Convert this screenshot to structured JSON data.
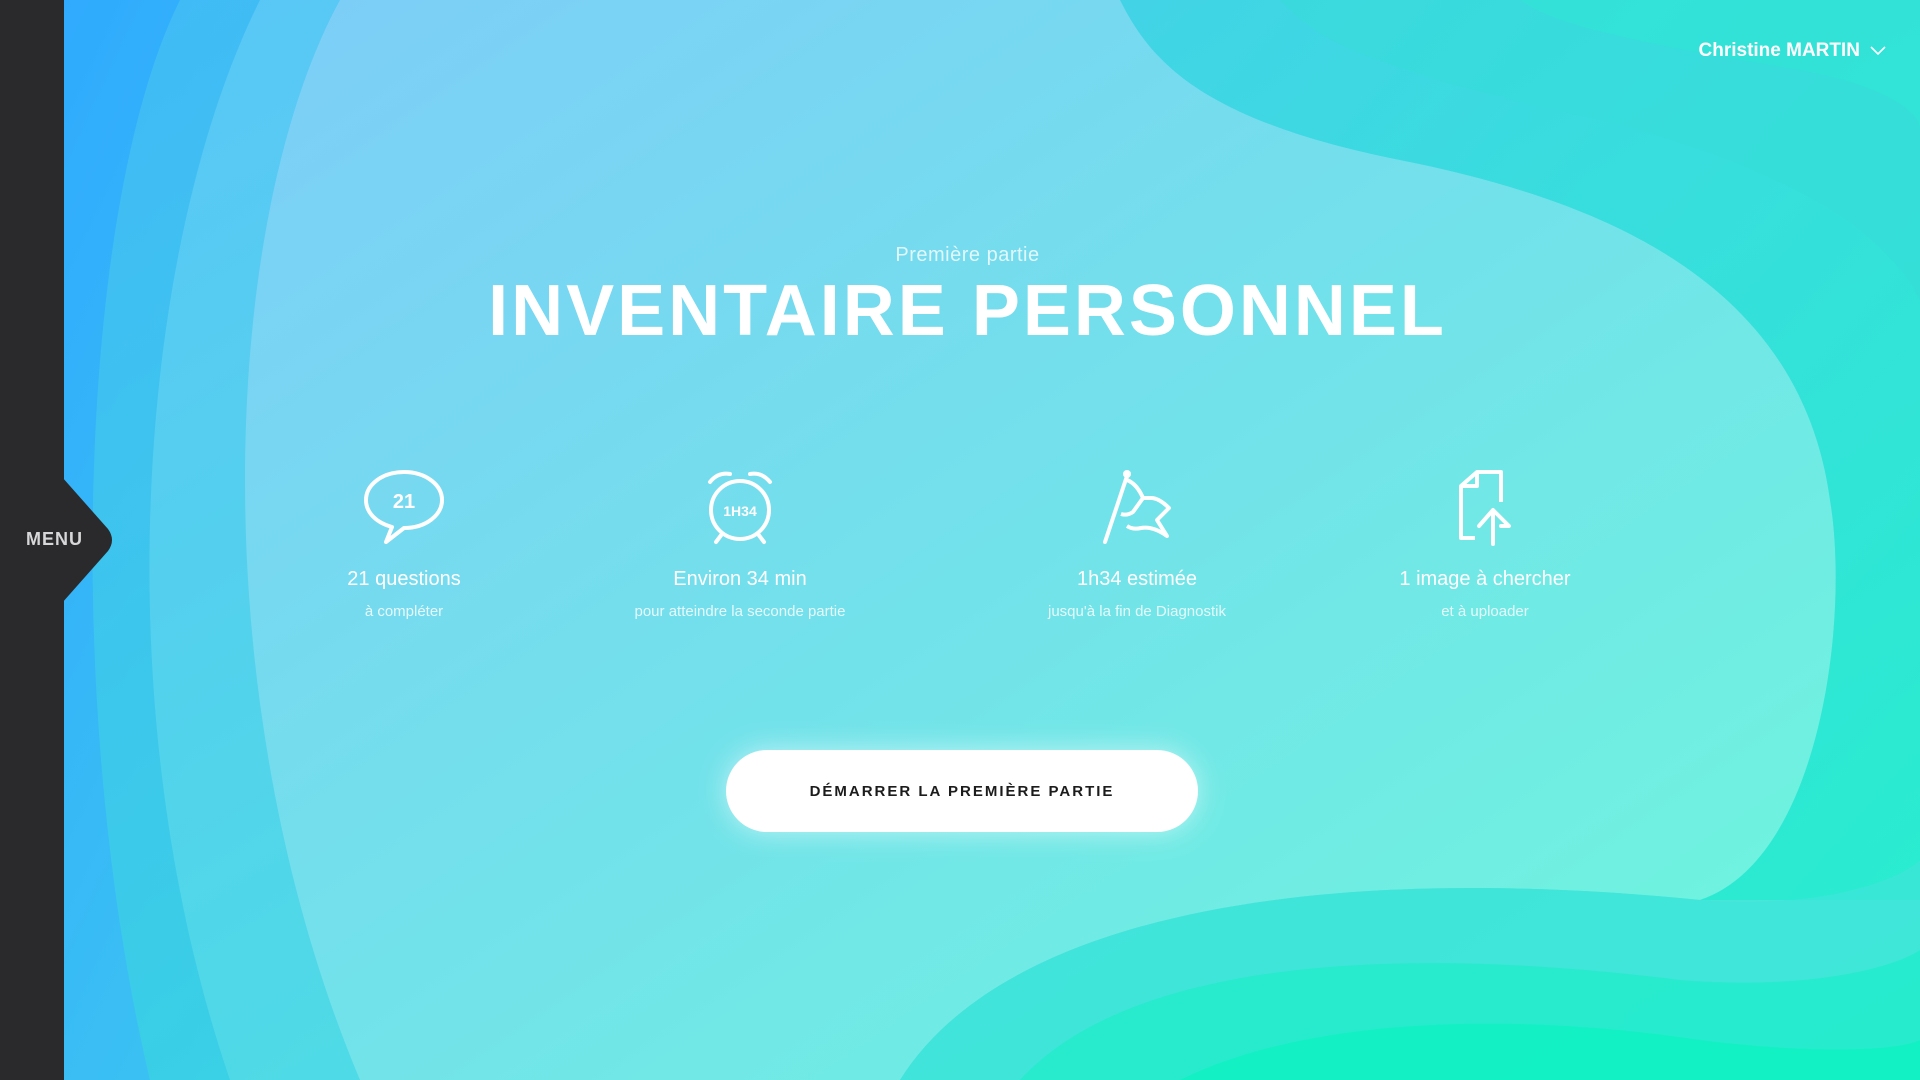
{
  "sidebar": {
    "menu_label": "MENU"
  },
  "user": {
    "name": "Christine MARTIN",
    "icon": "chevron-down-icon"
  },
  "header": {
    "subtitle": "Première partie",
    "title": "INVENTAIRE PERSONNEL"
  },
  "stats": [
    {
      "icon": "speech-bubble-icon",
      "icon_text": "21",
      "main": "21 questions",
      "sub": "à compléter"
    },
    {
      "icon": "alarm-clock-icon",
      "icon_text": "1H34",
      "main": "Environ 34 min",
      "sub": "pour atteindre la seconde partie"
    },
    {
      "icon": "flag-icon",
      "main": "1h34 estimée",
      "sub": "jusqu'à la fin de Diagnostik"
    },
    {
      "icon": "file-upload-icon",
      "main": "1 image à chercher",
      "sub": "et à uploader"
    }
  ],
  "cta": {
    "label": "DÉMARRER LA PREMIÈRE PARTIE"
  },
  "colors": {
    "sidebar": "#2a2a2c",
    "gradient_start": "#2ea8ff",
    "gradient_end": "#1ff0c8",
    "button_bg": "#ffffff",
    "button_text": "#1c1c1c"
  }
}
